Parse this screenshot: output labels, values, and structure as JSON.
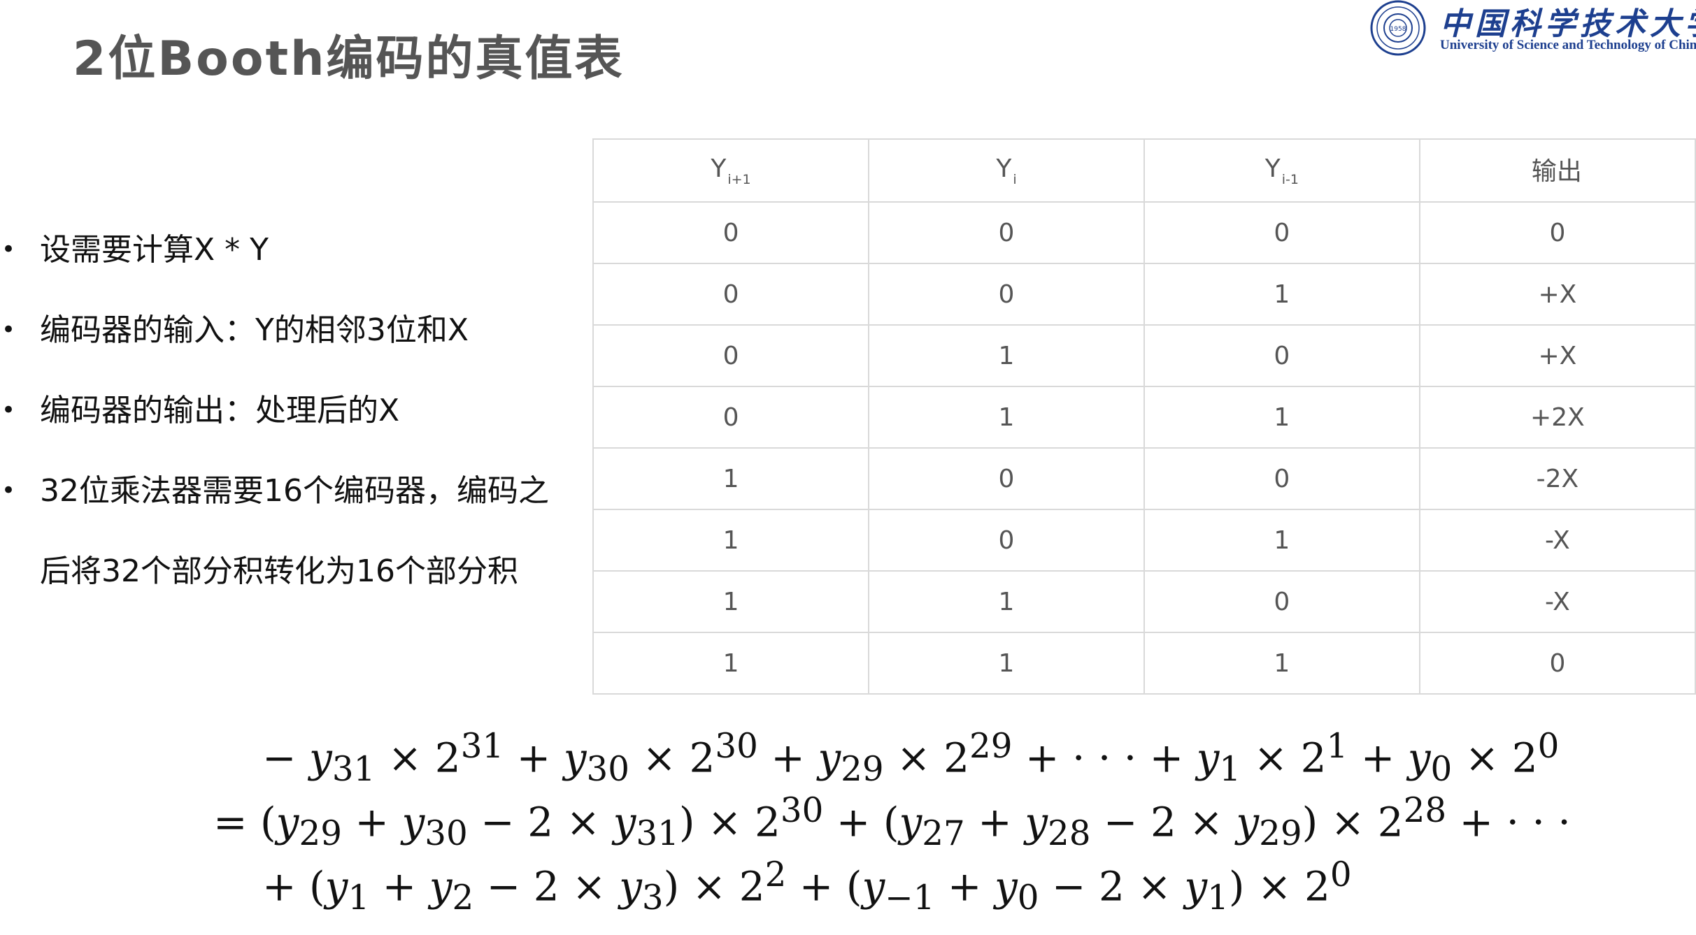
{
  "title": "2位Booth编码的真值表",
  "logo": {
    "name_cn": "中国科学技术大学",
    "name_en": "University of Science and Technology of China",
    "seal_year": "1958"
  },
  "bullets": [
    "设需要计算X * Y",
    "编码器的输入：Y的相邻3位和X",
    "编码器的输出：处理后的X",
    "32位乘法器需要16个编码器，编码之",
    "后将32个部分积转化为16个部分积"
  ],
  "bullet_glyph": "•",
  "table": {
    "headers": [
      {
        "main": "Y",
        "sub": "i+1"
      },
      {
        "main": "Y",
        "sub": "i"
      },
      {
        "main": "Y",
        "sub": "i-1"
      },
      {
        "main": "输出",
        "sub": ""
      }
    ],
    "rows": [
      [
        "0",
        "0",
        "0",
        "0"
      ],
      [
        "0",
        "0",
        "1",
        "+X"
      ],
      [
        "0",
        "1",
        "0",
        "+X"
      ],
      [
        "0",
        "1",
        "1",
        "+2X"
      ],
      [
        "1",
        "0",
        "0",
        "-2X"
      ],
      [
        "1",
        "0",
        "1",
        "-X"
      ],
      [
        "1",
        "1",
        "0",
        "-X"
      ],
      [
        "1",
        "1",
        "1",
        "0"
      ]
    ]
  },
  "formula": [
    "− y<sub>31</sub> × 2<sup>31</sup> + y<sub>30</sub> × 2<sup>30</sup> + y<sub>29</sub> × 2<sup>29</sup> + · · · + y<sub>1</sub> × 2<sup>1</sup> + y<sub>0</sub> × 2<sup>0</sup>",
    "= (y<sub>29</sub> + y<sub>30</sub> − 2 × y<sub>31</sub>) × 2<sup>30</sup> + (y<sub>27</sub> + y<sub>28</sub> − 2 × y<sub>29</sub>) × 2<sup>28</sup> + · · ·",
    "+ (y<sub>1</sub> + y<sub>2</sub> − 2 × y<sub>3</sub>) × 2<sup>2</sup> + (y<sub>−1</sub> + y<sub>0</sub> − 2 × y<sub>1</sub>) × 2<sup>0</sup>"
  ],
  "colors": {
    "title": "#555555",
    "logo_blue": "#1d3f8f",
    "table_border": "#d9d9d9",
    "table_text": "#555555"
  }
}
